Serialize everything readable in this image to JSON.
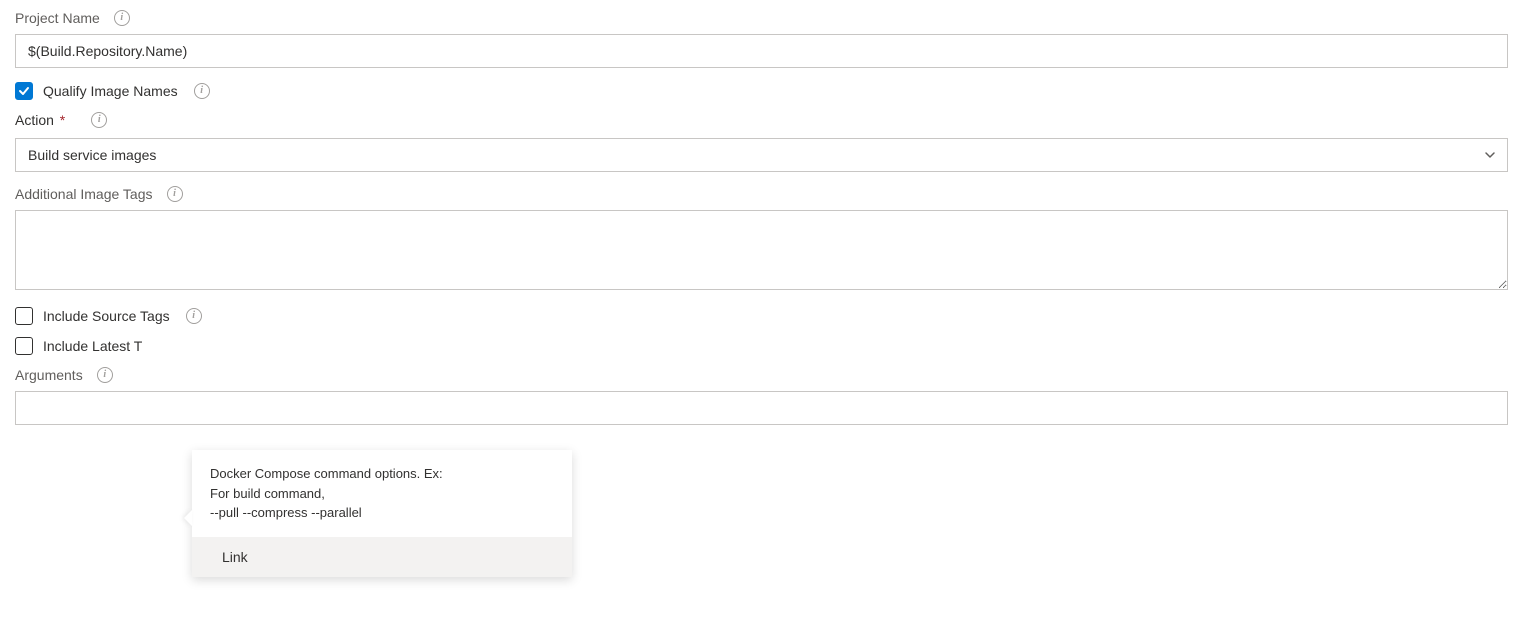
{
  "projectName": {
    "label": "Project Name",
    "value": "$(Build.Repository.Name)"
  },
  "qualifyImageNames": {
    "label": "Qualify Image Names",
    "checked": true
  },
  "action": {
    "label": "Action",
    "selected": "Build service images"
  },
  "additionalImageTags": {
    "label": "Additional Image Tags",
    "value": ""
  },
  "includeSourceTags": {
    "label": "Include Source Tags",
    "checked": false
  },
  "includeLatestTag": {
    "label": "Include Latest T",
    "checked": false
  },
  "arguments": {
    "label": "Arguments",
    "value": ""
  },
  "tooltip": {
    "line1": "Docker Compose command options. Ex:",
    "line2": "For build command,",
    "line3": "--pull --compress --parallel",
    "linkLabel": "Link"
  }
}
